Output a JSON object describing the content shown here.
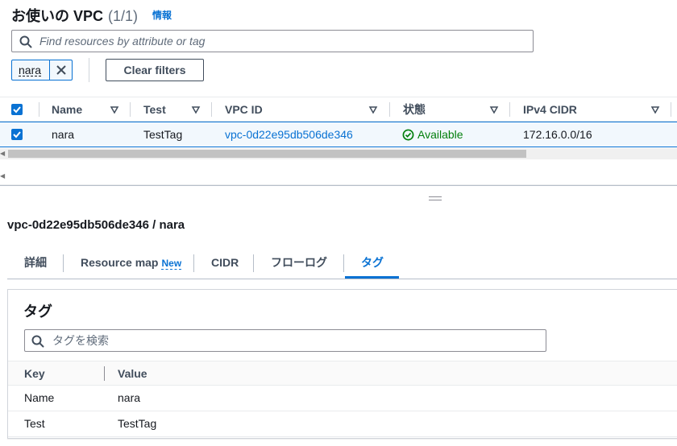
{
  "header": {
    "title": "お使いの VPC",
    "count": "(1/1)",
    "info_link": "情報"
  },
  "search": {
    "placeholder": "Find resources by attribute or tag",
    "value": ""
  },
  "filter_token": {
    "label": "nara"
  },
  "clear_filters_label": "Clear filters",
  "table": {
    "columns": [
      {
        "label": "Name"
      },
      {
        "label": "Test"
      },
      {
        "label": "VPC ID"
      },
      {
        "label": "状態"
      },
      {
        "label": "IPv4 CIDR"
      }
    ],
    "rows": [
      {
        "selected": true,
        "name": "nara",
        "test": "TestTag",
        "vpc_id": "vpc-0d22e95db506de346",
        "status": "Available",
        "ipv4_cidr": "172.16.0.0/16"
      }
    ]
  },
  "detail": {
    "title": "vpc-0d22e95db506de346 / nara",
    "tabs": [
      {
        "label": "詳細"
      },
      {
        "label": "Resource map",
        "badge": "New"
      },
      {
        "label": "CIDR"
      },
      {
        "label": "フローログ"
      },
      {
        "label": "タグ",
        "active": true
      }
    ],
    "panel": {
      "title": "タグ",
      "search_placeholder": "タグを検索",
      "columns": {
        "key": "Key",
        "value": "Value"
      },
      "rows": [
        {
          "key": "Name",
          "value": "nara"
        },
        {
          "key": "Test",
          "value": "TestTag"
        }
      ]
    }
  },
  "colors": {
    "accent": "#0972d3",
    "success": "#037f0c",
    "selected_row_bg": "#f2f8fd"
  },
  "icons": {
    "search": "search-icon",
    "close": "close-icon",
    "sort": "sort-caret-icon",
    "status": "check-circle-icon",
    "checkbox": "checkbox-checked-icon"
  }
}
